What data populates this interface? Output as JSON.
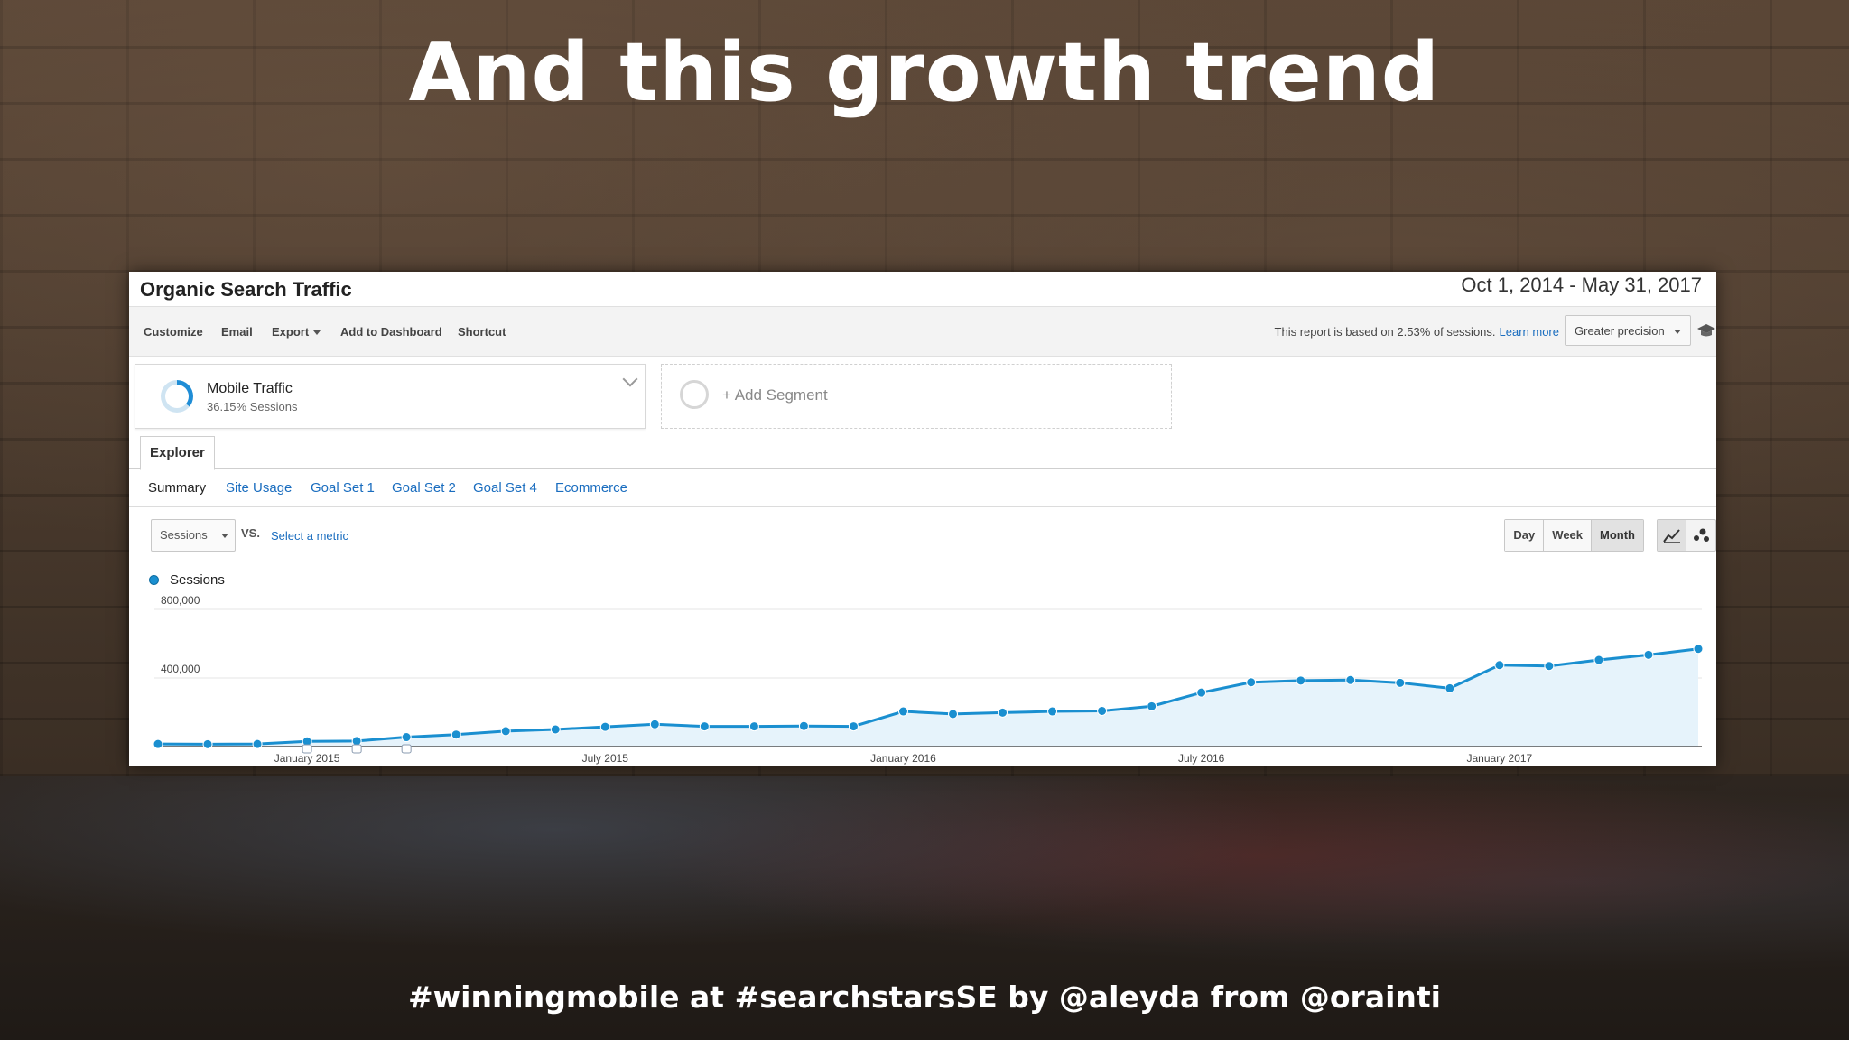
{
  "slide": {
    "title": "And this growth trend",
    "footer": "#winningmobile at #searchstarsSE by @aleyda from @orainti"
  },
  "report": {
    "title": "Organic Search Traffic",
    "date_range": "Oct 1, 2014 - May 31, 2017"
  },
  "toolbar": {
    "customize": "Customize",
    "email": "Email",
    "export": "Export",
    "add_to_dashboard": "Add to Dashboard",
    "shortcut": "Shortcut",
    "sampling_note": "This report is based on 2.53% of sessions.",
    "learn_more": "Learn more",
    "precision": "Greater precision"
  },
  "segment": {
    "name": "Mobile Traffic",
    "share": "36.15% Sessions",
    "add_label": "+ Add Segment"
  },
  "tabs": {
    "explorer": "Explorer",
    "subtabs": [
      "Summary",
      "Site Usage",
      "Goal Set 1",
      "Goal Set 2",
      "Goal Set 4",
      "Ecommerce"
    ]
  },
  "controls": {
    "metric": "Sessions",
    "vs": "VS.",
    "select_metric": "Select a metric",
    "periods": [
      "Day",
      "Week",
      "Month"
    ],
    "active_period": "Month"
  },
  "colors": {
    "series": "#1a8fd0",
    "area": "#e6f3fb",
    "link": "#1a6dbf"
  },
  "chart_data": {
    "type": "area",
    "series": [
      {
        "name": "Sessions",
        "x": [
          "2014-10",
          "2014-11",
          "2014-12",
          "2015-01",
          "2015-02",
          "2015-03",
          "2015-04",
          "2015-05",
          "2015-06",
          "2015-07",
          "2015-08",
          "2015-09",
          "2015-10",
          "2015-11",
          "2015-12",
          "2016-01",
          "2016-02",
          "2016-03",
          "2016-04",
          "2016-05",
          "2016-06",
          "2016-07",
          "2016-08",
          "2016-09",
          "2016-10",
          "2016-11",
          "2016-12",
          "2017-01",
          "2017-02",
          "2017-03",
          "2017-04",
          "2017-05"
        ],
        "values": [
          15000,
          14000,
          15000,
          30000,
          32000,
          55000,
          70000,
          90000,
          100000,
          115000,
          130000,
          118000,
          118000,
          120000,
          118000,
          205000,
          190000,
          198000,
          205000,
          208000,
          235000,
          315000,
          375000,
          385000,
          388000,
          372000,
          340000,
          475000,
          470000,
          505000,
          535000,
          570000
        ]
      }
    ],
    "ylim": [
      0,
      800000
    ],
    "y_ticks": [
      {
        "value": 800000,
        "label": "800,000"
      },
      {
        "value": 400000,
        "label": "400,000"
      }
    ],
    "x_ticks": [
      {
        "at": "2015-01",
        "label": "January 2015"
      },
      {
        "at": "2015-07",
        "label": "July 2015"
      },
      {
        "at": "2016-01",
        "label": "January 2016"
      },
      {
        "at": "2016-07",
        "label": "July 2016"
      },
      {
        "at": "2017-01",
        "label": "January 2017"
      }
    ],
    "annotations_at": [
      "2015-01",
      "2015-02",
      "2015-03"
    ],
    "grid": true,
    "legend": "top-left"
  }
}
